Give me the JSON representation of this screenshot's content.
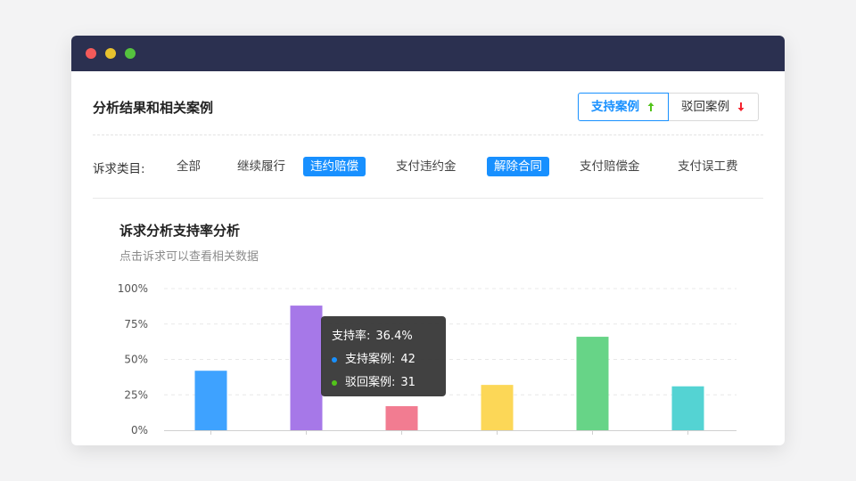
{
  "colors": {
    "titlebar": "#2b3050",
    "accent": "#1890ff",
    "up_arrow": "#52c41a",
    "down_arrow": "#f5222d"
  },
  "header": {
    "title": "分析结果和相关案例",
    "toggle": {
      "support_label": "支持案例",
      "support_icon": "arrow-up-icon",
      "reject_label": "驳回案例",
      "reject_icon": "arrow-down-icon",
      "selected": "support"
    }
  },
  "filter": {
    "label": "诉求类目:",
    "items": [
      {
        "label": "全部",
        "active": false
      },
      {
        "label": "继续履行",
        "active": false
      },
      {
        "label": "违约赔偿",
        "active": true
      },
      {
        "label": "支付违约金",
        "active": false
      },
      {
        "label": "解除合同",
        "active": true
      },
      {
        "label": "支付赔偿金",
        "active": false
      },
      {
        "label": "支付误工费",
        "active": false
      }
    ]
  },
  "chart_data": {
    "type": "bar",
    "title": "诉求分析支持率分析",
    "subtitle": "点击诉求可以查看相关数据",
    "y_ticks": [
      "100%",
      "75%",
      "50%",
      "25%",
      "0%"
    ],
    "ylim": [
      0,
      100
    ],
    "grid": true,
    "values": [
      42,
      88,
      17,
      32,
      66,
      31
    ],
    "colors": [
      "#3ea2ff",
      "#a678e8",
      "#f27c91",
      "#fcd757",
      "#67d487",
      "#54d3d3"
    ]
  },
  "tooltip": {
    "rate_label": "支持率:",
    "rate_value": "36.4%",
    "support_label": "支持案例:",
    "support_value": "42",
    "support_color": "#1890ff",
    "reject_label": "驳回案例:",
    "reject_value": "31",
    "reject_color": "#52c41a"
  }
}
